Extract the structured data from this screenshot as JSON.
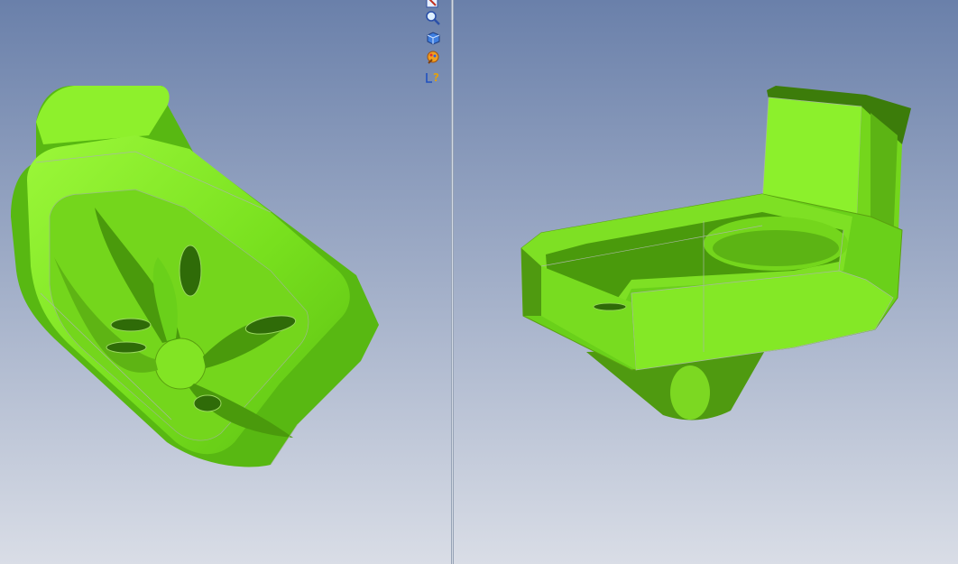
{
  "colors": {
    "bg_top": "#6a80aa",
    "bg_bottom": "#d9dde6",
    "part_light": "#8cf02a",
    "part_mid": "#6fd81a",
    "part_dark": "#3f8f0c",
    "part_shadow": "#2f6b08",
    "edge_line": "#a8b8a0"
  },
  "viewports": [
    {
      "id": "left",
      "view": "bottom-isometric"
    },
    {
      "id": "right",
      "view": "top-isometric"
    }
  ],
  "toolbar": {
    "tools": [
      {
        "id": "select",
        "icon": "select-arrow-icon"
      },
      {
        "id": "zoom",
        "icon": "zoom-magnifier-icon"
      },
      {
        "id": "view-cube",
        "icon": "view-cube-icon"
      },
      {
        "id": "appearance",
        "icon": "appearance-paint-icon"
      },
      {
        "id": "help",
        "icon": "whats-this-help-icon"
      }
    ]
  }
}
